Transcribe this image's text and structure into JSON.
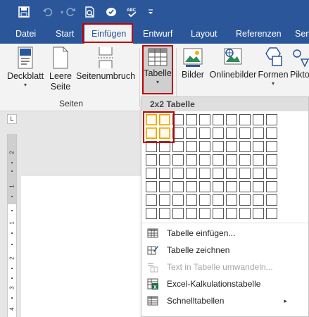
{
  "quick_access": {
    "items": [
      "save-icon",
      "undo-icon",
      "redo-icon",
      "print-preview-icon",
      "touch-mode-icon",
      "spelling-icon",
      "customize-icon"
    ]
  },
  "tabs": [
    {
      "label": "Datei"
    },
    {
      "label": "Start"
    },
    {
      "label": "Einfügen"
    },
    {
      "label": "Entwurf"
    },
    {
      "label": "Layout"
    },
    {
      "label": "Referenzen"
    },
    {
      "label": "Sen"
    }
  ],
  "ribbon": {
    "deckblatt": "Deckblatt",
    "leere_seite_1": "Leere",
    "leere_seite_2": "Seite",
    "seitenumbruch": "Seitenumbruch",
    "tabelle": "Tabelle",
    "bilder": "Bilder",
    "onlinebilder": "Onlinebilder",
    "formen": "Formen",
    "pikto": "Pikto",
    "group_seiten": "Seiten",
    "caret": "▾"
  },
  "ruler": {
    "corner": "L",
    "numbers": [
      "2",
      "1",
      "1",
      "2",
      "3",
      "4"
    ]
  },
  "table_menu": {
    "header": "2x2 Tabelle",
    "rows": 8,
    "cols": 10,
    "selected_rows": 2,
    "selected_cols": 2,
    "items": [
      {
        "label": "Tabelle einfügen...",
        "enabled": true
      },
      {
        "label": "Tabelle zeichnen",
        "enabled": true
      },
      {
        "label": "Text in Tabelle umwandeln...",
        "enabled": false
      },
      {
        "label": "Excel-Kalkulationstabelle",
        "enabled": true
      },
      {
        "label": "Schnelltabellen",
        "enabled": true,
        "submenu": "▸"
      }
    ]
  },
  "colors": {
    "accent": "#2b579a",
    "highlight": "#c00000",
    "selection": "#e8a200"
  }
}
